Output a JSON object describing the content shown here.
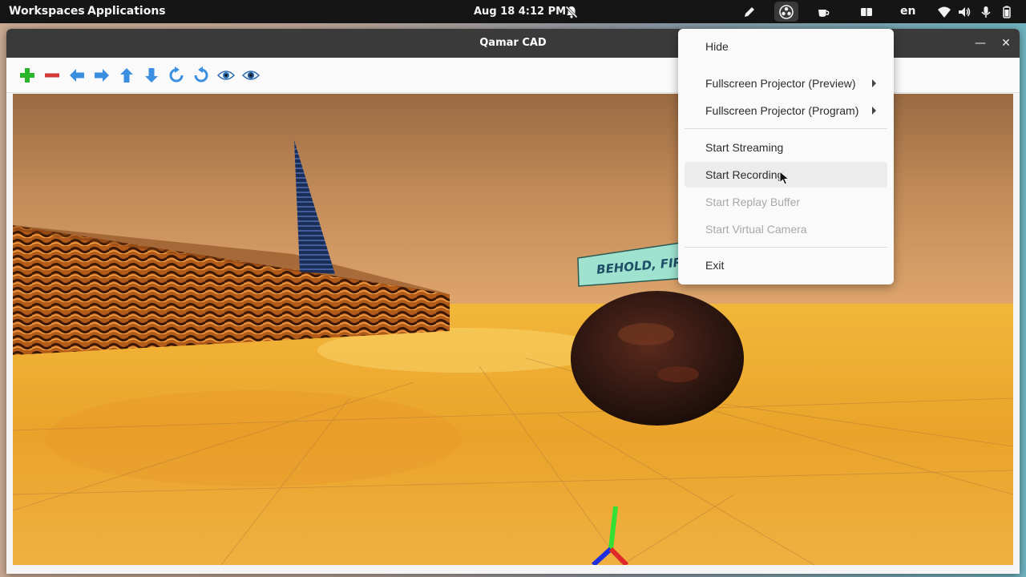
{
  "topbar": {
    "workspaces": "Workspaces",
    "applications": "Applications",
    "clock": "Aug 18  4:12 PM",
    "language": "en",
    "icons": [
      "bell-off-icon",
      "pen-icon",
      "obs-icon",
      "coffee-icon",
      "window-icon",
      "wifi-icon",
      "volume-icon",
      "microphone-icon",
      "battery-icon"
    ]
  },
  "window": {
    "title": "Qamar CAD",
    "controls": [
      "minimize-icon",
      "close-icon"
    ],
    "toolbar": [
      "add-icon",
      "remove-icon",
      "arrow-left-icon",
      "arrow-right-icon",
      "arrow-up-icon",
      "arrow-down-icon",
      "rotate-cw-icon",
      "rotate-ccw-icon",
      "eye-icon",
      "eye-alt-icon"
    ],
    "scene": {
      "sign_text": "BEHOLD, FIRE"
    }
  },
  "menu": {
    "items": [
      {
        "label": "Hide",
        "state": "normal"
      },
      {
        "label": "Fullscreen Projector (Preview)",
        "state": "submenu"
      },
      {
        "label": "Fullscreen Projector (Program)",
        "state": "submenu"
      },
      {
        "label": "Start Streaming",
        "state": "normal"
      },
      {
        "label": "Start Recording",
        "state": "hover"
      },
      {
        "label": "Start Replay Buffer",
        "state": "disabled"
      },
      {
        "label": "Start Virtual Camera",
        "state": "disabled"
      },
      {
        "label": "Exit",
        "state": "normal"
      }
    ]
  },
  "colors": {
    "topbar": "#151515",
    "titlebar": "#3a3a3a",
    "toolbar_green": "#2bb52b",
    "toolbar_red": "#d23a3a",
    "toolbar_blue": "#3b8fe0",
    "lava": "#e8a030",
    "sign": "#9ee2cf"
  }
}
